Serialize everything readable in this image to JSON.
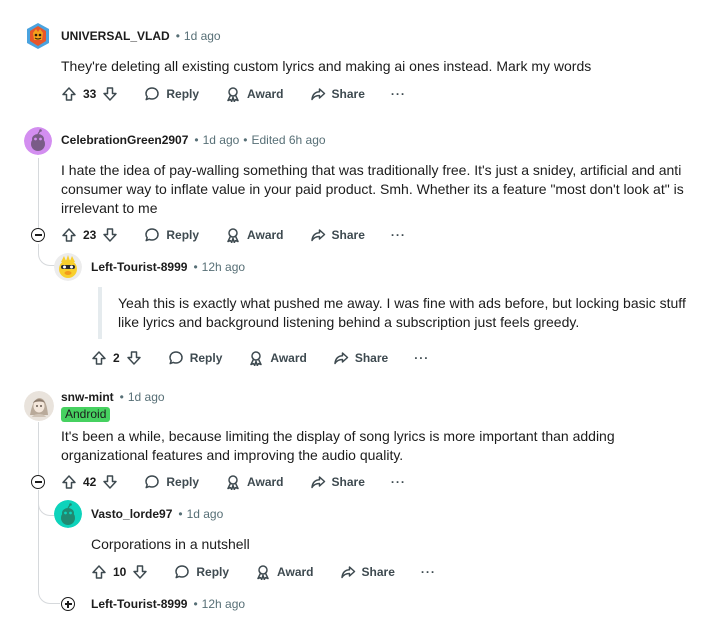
{
  "comments": [
    {
      "username": "UNIVERSAL_VLAD",
      "time": "1d ago",
      "body": "They're deleting all existing custom lyrics and making ai ones instead. Mark my words",
      "votes": "33",
      "reply": "Reply",
      "award": "Award",
      "share": "Share",
      "more": "···"
    },
    {
      "username": "CelebrationGreen2907",
      "time": "1d ago",
      "edited": "Edited 6h ago",
      "body": "I hate the idea of pay-walling something that was traditionally free. It's just a snidey, artificial and anti consumer way to inflate value in your paid product. Smh. Whether its a feature \"most don't look at\" is irrelevant to me",
      "votes": "23",
      "reply": "Reply",
      "award": "Award",
      "share": "Share",
      "more": "···",
      "replies": [
        {
          "username": "Left-Tourist-8999",
          "time": "12h ago",
          "quote": "Yeah this is exactly what pushed me away. I was fine with ads before, but locking basic stuff like lyrics and background listening behind a subscription just feels greedy.",
          "votes": "2",
          "reply": "Reply",
          "award": "Award",
          "share": "Share",
          "more": "···"
        }
      ]
    },
    {
      "username": "snw-mint",
      "time": "1d ago",
      "flair": "Android",
      "body": "It's been a while, because limiting the display of song lyrics is more important than adding organizational features and improving the audio quality.",
      "votes": "42",
      "reply": "Reply",
      "award": "Award",
      "share": "Share",
      "more": "···",
      "replies": [
        {
          "username": "Vasto_lorde97",
          "time": "1d ago",
          "body": "Corporations in a nutshell",
          "votes": "10",
          "reply": "Reply",
          "award": "Award",
          "share": "Share",
          "more": "···"
        },
        {
          "username": "Left-Tourist-8999",
          "time": "12h ago"
        }
      ]
    }
  ],
  "colors": {
    "flair_bg": "#46d160",
    "avatar_purple": "#d38ef0",
    "avatar_teal": "#0dd3bb",
    "meta_gray": "#576f76"
  }
}
